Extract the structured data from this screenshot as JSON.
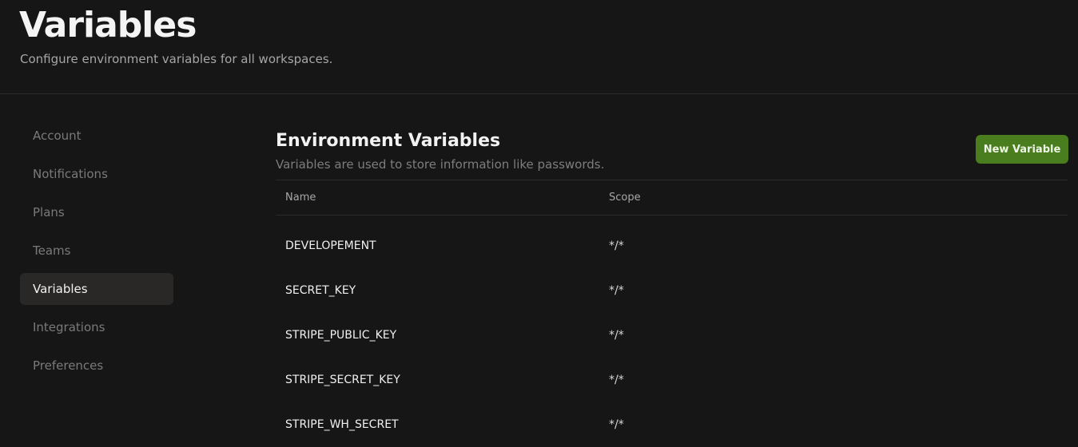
{
  "header": {
    "title": "Variables",
    "subtitle": "Configure environment variables for all workspaces."
  },
  "sidebar": {
    "items": [
      {
        "label": "Account",
        "active": false
      },
      {
        "label": "Notifications",
        "active": false
      },
      {
        "label": "Plans",
        "active": false
      },
      {
        "label": "Teams",
        "active": false
      },
      {
        "label": "Variables",
        "active": true
      },
      {
        "label": "Integrations",
        "active": false
      },
      {
        "label": "Preferences",
        "active": false
      }
    ]
  },
  "main": {
    "title": "Environment Variables",
    "description": "Variables are used to store information like passwords.",
    "new_button_label": "New Variable",
    "table": {
      "columns": [
        "Name",
        "Scope"
      ],
      "rows": [
        {
          "name": "DEVELOPEMENT",
          "scope": "*/*"
        },
        {
          "name": "SECRET_KEY",
          "scope": "*/*"
        },
        {
          "name": "STRIPE_PUBLIC_KEY",
          "scope": "*/*"
        },
        {
          "name": "STRIPE_SECRET_KEY",
          "scope": "*/*"
        },
        {
          "name": "STRIPE_WH_SECRET",
          "scope": "*/*"
        }
      ]
    }
  },
  "colors": {
    "background": "#161616",
    "accent_button": "#4a7d1e",
    "active_nav": "#2a2727"
  }
}
